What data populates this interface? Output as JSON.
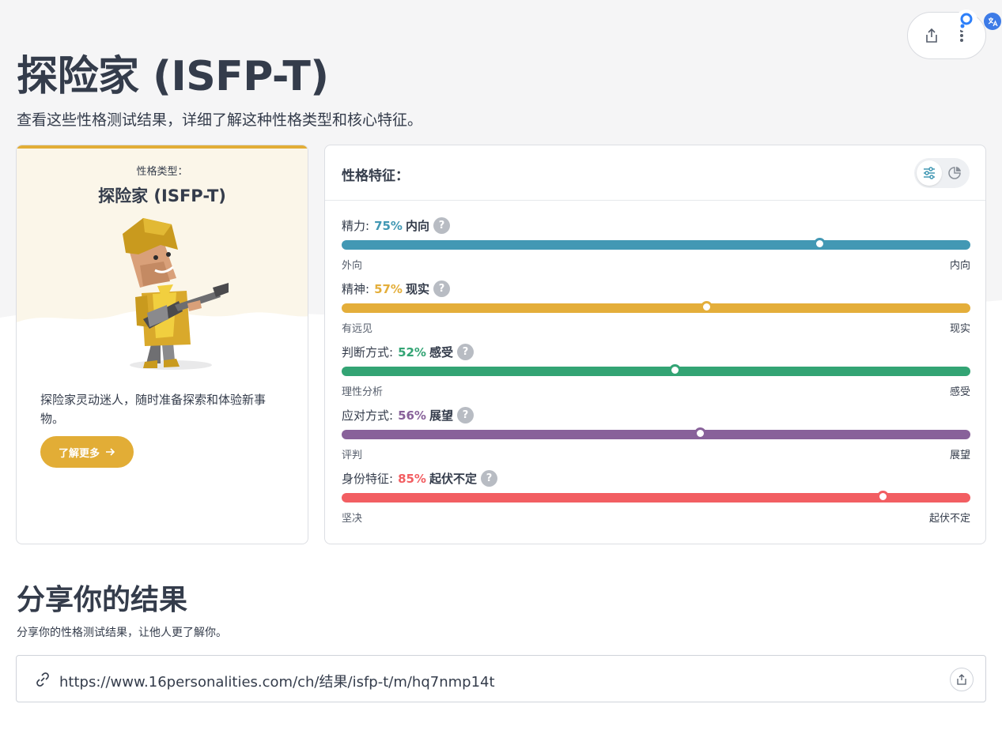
{
  "header": {
    "title": "探险家 (ISFP-T)",
    "subtitle": "查看这些性格测试结果，详细了解这种性格类型和核心特征。"
  },
  "type_card": {
    "label": "性格类型：",
    "name": "探险家 (ISFP-T)",
    "description": "探险家灵动迷人，随时准备探索和体验新事物。",
    "button_label": "了解更多",
    "accent_color": "#e2ad36"
  },
  "traits": {
    "title": "性格特征：",
    "items": [
      {
        "name": "精力:",
        "percent": "75%",
        "side": "内向",
        "left": "外向",
        "right": "内向",
        "value": 0.76,
        "color": "#4298b4"
      },
      {
        "name": "精神:",
        "percent": "57%",
        "side": "现实",
        "left": "有远见",
        "right": "现实",
        "value": 0.58,
        "color": "#e4ae3a"
      },
      {
        "name": "判断方式:",
        "percent": "52%",
        "side": "感受",
        "left": "理性分析",
        "right": "感受",
        "value": 0.53,
        "color": "#33a474"
      },
      {
        "name": "应对方式:",
        "percent": "56%",
        "side": "展望",
        "left": "评判",
        "right": "展望",
        "value": 0.57,
        "color": "#88619a"
      },
      {
        "name": "身份特征:",
        "percent": "85%",
        "side": "起伏不定",
        "left": "坚决",
        "right": "起伏不定",
        "value": 0.86,
        "color": "#f25e62"
      }
    ],
    "help_glyph": "?"
  },
  "share": {
    "title": "分享你的结果",
    "subtitle": "分享你的性格测试结果，让他人更了解你。",
    "url": "https://www.16personalities.com/ch/结果/isfp-t/m/hq7nmp14t"
  }
}
